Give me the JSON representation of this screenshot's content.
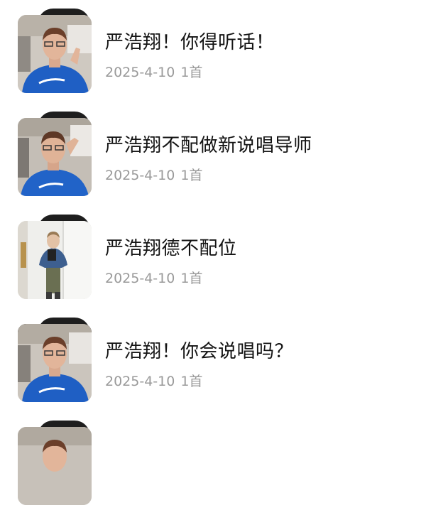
{
  "playlist": {
    "items": [
      {
        "title": "严浩翔！你得听话！",
        "date": "2025-4-10",
        "count": "1首",
        "cover": "car-selfie-cover-icon"
      },
      {
        "title": "严浩翔不配做新说唱导师",
        "date": "2025-4-10",
        "count": "1首",
        "cover": "car-selfie-cover-icon"
      },
      {
        "title": "严浩翔德不配位",
        "date": "2025-4-10",
        "count": "1首",
        "cover": "mirror-selfie-cover-icon"
      },
      {
        "title": "严浩翔！你会说唱吗？",
        "date": "2025-4-10",
        "count": "1首",
        "cover": "car-selfie-cover-icon"
      },
      {
        "title": "",
        "date": "",
        "count": "",
        "cover": "car-selfie-cover-icon"
      }
    ]
  },
  "colors": {
    "title_text": "#141414",
    "meta_text": "#9a9a9a",
    "shirt_blue": "#1f5fc4",
    "vinyl": "#1e1e1e"
  }
}
